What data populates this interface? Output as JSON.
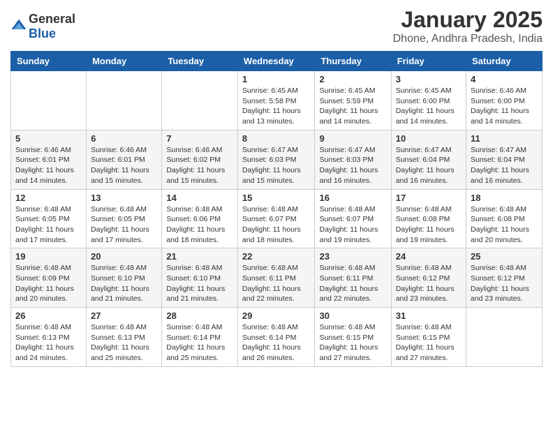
{
  "header": {
    "logo_general": "General",
    "logo_blue": "Blue",
    "month_year": "January 2025",
    "location": "Dhone, Andhra Pradesh, India"
  },
  "calendar": {
    "days_of_week": [
      "Sunday",
      "Monday",
      "Tuesday",
      "Wednesday",
      "Thursday",
      "Friday",
      "Saturday"
    ],
    "weeks": [
      [
        {
          "day": "",
          "info": ""
        },
        {
          "day": "",
          "info": ""
        },
        {
          "day": "",
          "info": ""
        },
        {
          "day": "1",
          "info": "Sunrise: 6:45 AM\nSunset: 5:58 PM\nDaylight: 11 hours\nand 13 minutes."
        },
        {
          "day": "2",
          "info": "Sunrise: 6:45 AM\nSunset: 5:59 PM\nDaylight: 11 hours\nand 14 minutes."
        },
        {
          "day": "3",
          "info": "Sunrise: 6:45 AM\nSunset: 6:00 PM\nDaylight: 11 hours\nand 14 minutes."
        },
        {
          "day": "4",
          "info": "Sunrise: 6:46 AM\nSunset: 6:00 PM\nDaylight: 11 hours\nand 14 minutes."
        }
      ],
      [
        {
          "day": "5",
          "info": "Sunrise: 6:46 AM\nSunset: 6:01 PM\nDaylight: 11 hours\nand 14 minutes."
        },
        {
          "day": "6",
          "info": "Sunrise: 6:46 AM\nSunset: 6:01 PM\nDaylight: 11 hours\nand 15 minutes."
        },
        {
          "day": "7",
          "info": "Sunrise: 6:46 AM\nSunset: 6:02 PM\nDaylight: 11 hours\nand 15 minutes."
        },
        {
          "day": "8",
          "info": "Sunrise: 6:47 AM\nSunset: 6:03 PM\nDaylight: 11 hours\nand 15 minutes."
        },
        {
          "day": "9",
          "info": "Sunrise: 6:47 AM\nSunset: 6:03 PM\nDaylight: 11 hours\nand 16 minutes."
        },
        {
          "day": "10",
          "info": "Sunrise: 6:47 AM\nSunset: 6:04 PM\nDaylight: 11 hours\nand 16 minutes."
        },
        {
          "day": "11",
          "info": "Sunrise: 6:47 AM\nSunset: 6:04 PM\nDaylight: 11 hours\nand 16 minutes."
        }
      ],
      [
        {
          "day": "12",
          "info": "Sunrise: 6:48 AM\nSunset: 6:05 PM\nDaylight: 11 hours\nand 17 minutes."
        },
        {
          "day": "13",
          "info": "Sunrise: 6:48 AM\nSunset: 6:05 PM\nDaylight: 11 hours\nand 17 minutes."
        },
        {
          "day": "14",
          "info": "Sunrise: 6:48 AM\nSunset: 6:06 PM\nDaylight: 11 hours\nand 18 minutes."
        },
        {
          "day": "15",
          "info": "Sunrise: 6:48 AM\nSunset: 6:07 PM\nDaylight: 11 hours\nand 18 minutes."
        },
        {
          "day": "16",
          "info": "Sunrise: 6:48 AM\nSunset: 6:07 PM\nDaylight: 11 hours\nand 19 minutes."
        },
        {
          "day": "17",
          "info": "Sunrise: 6:48 AM\nSunset: 6:08 PM\nDaylight: 11 hours\nand 19 minutes."
        },
        {
          "day": "18",
          "info": "Sunrise: 6:48 AM\nSunset: 6:08 PM\nDaylight: 11 hours\nand 20 minutes."
        }
      ],
      [
        {
          "day": "19",
          "info": "Sunrise: 6:48 AM\nSunset: 6:09 PM\nDaylight: 11 hours\nand 20 minutes."
        },
        {
          "day": "20",
          "info": "Sunrise: 6:48 AM\nSunset: 6:10 PM\nDaylight: 11 hours\nand 21 minutes."
        },
        {
          "day": "21",
          "info": "Sunrise: 6:48 AM\nSunset: 6:10 PM\nDaylight: 11 hours\nand 21 minutes."
        },
        {
          "day": "22",
          "info": "Sunrise: 6:48 AM\nSunset: 6:11 PM\nDaylight: 11 hours\nand 22 minutes."
        },
        {
          "day": "23",
          "info": "Sunrise: 6:48 AM\nSunset: 6:11 PM\nDaylight: 11 hours\nand 22 minutes."
        },
        {
          "day": "24",
          "info": "Sunrise: 6:48 AM\nSunset: 6:12 PM\nDaylight: 11 hours\nand 23 minutes."
        },
        {
          "day": "25",
          "info": "Sunrise: 6:48 AM\nSunset: 6:12 PM\nDaylight: 11 hours\nand 23 minutes."
        }
      ],
      [
        {
          "day": "26",
          "info": "Sunrise: 6:48 AM\nSunset: 6:13 PM\nDaylight: 11 hours\nand 24 minutes."
        },
        {
          "day": "27",
          "info": "Sunrise: 6:48 AM\nSunset: 6:13 PM\nDaylight: 11 hours\nand 25 minutes."
        },
        {
          "day": "28",
          "info": "Sunrise: 6:48 AM\nSunset: 6:14 PM\nDaylight: 11 hours\nand 25 minutes."
        },
        {
          "day": "29",
          "info": "Sunrise: 6:48 AM\nSunset: 6:14 PM\nDaylight: 11 hours\nand 26 minutes."
        },
        {
          "day": "30",
          "info": "Sunrise: 6:48 AM\nSunset: 6:15 PM\nDaylight: 11 hours\nand 27 minutes."
        },
        {
          "day": "31",
          "info": "Sunrise: 6:48 AM\nSunset: 6:15 PM\nDaylight: 11 hours\nand 27 minutes."
        },
        {
          "day": "",
          "info": ""
        }
      ]
    ]
  }
}
